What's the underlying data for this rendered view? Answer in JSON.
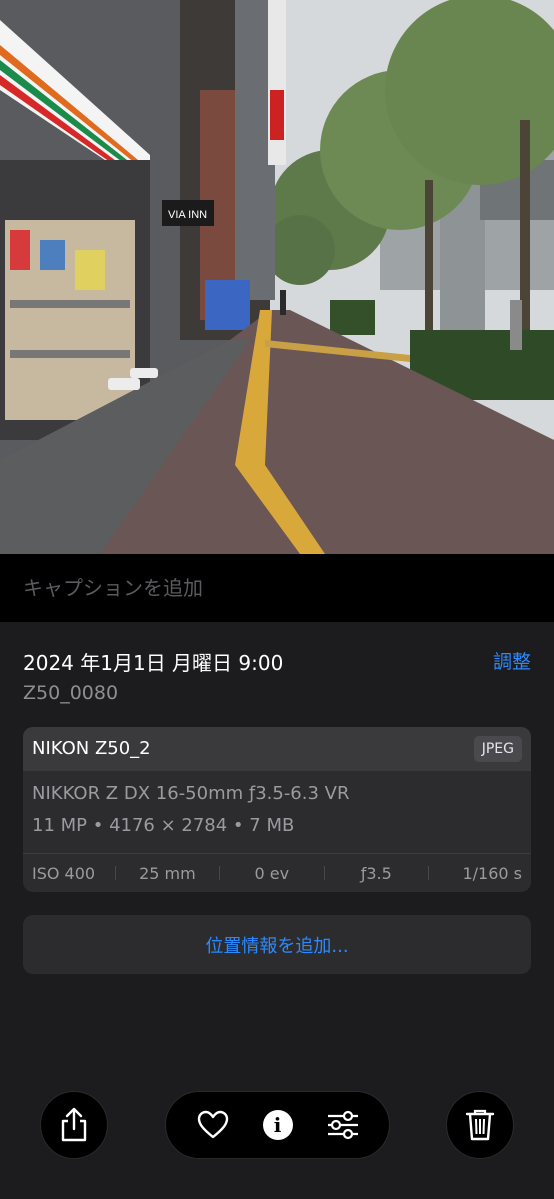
{
  "photo": {
    "store_sign": "",
    "hotel_sign": "VIA INN"
  },
  "caption": {
    "placeholder": "キャプションを追加"
  },
  "info": {
    "date": "2024 年1月1日 月曜日 9:00",
    "adjust_label": "調整",
    "filename": "Z50_0080",
    "camera": {
      "name": "NIKON Z50_2",
      "format_badge": "JPEG",
      "lens": "NIKKOR Z DX 16-50mm ƒ3.5-6.3 VR",
      "specs": "11 MP • 4176 × 2784 • 7 MB",
      "exif": {
        "iso": "ISO 400",
        "focal": "25 mm",
        "ev": "0 ev",
        "aperture": "ƒ3.5",
        "shutter": "1/160 s"
      }
    },
    "location_button": "位置情報を追加..."
  },
  "toolbar": {
    "share": "share-icon",
    "favorite": "heart-icon",
    "info": "i",
    "adjust": "sliders-icon",
    "delete": "trash-icon"
  },
  "colors": {
    "accent": "#2b8aff",
    "background": "#1c1c1e",
    "card": "#2c2c2e"
  }
}
